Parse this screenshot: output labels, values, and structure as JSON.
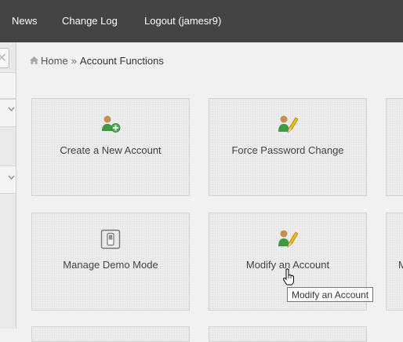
{
  "topnav": {
    "items": [
      {
        "label": "News"
      },
      {
        "label": "Change Log"
      },
      {
        "label": "Logout (jamesr9)"
      }
    ]
  },
  "sidebar": {
    "collapse_icon": "close-icon",
    "chevron_icon": "chevron-down-icon"
  },
  "breadcrumb": {
    "home_icon": "home-icon",
    "home": "Home",
    "separator": "»",
    "current": "Account Functions"
  },
  "tiles": [
    {
      "label": "Create a New Account",
      "icon": "user-add-icon"
    },
    {
      "label": "Force Password Change",
      "icon": "user-edit-icon"
    },
    {
      "label": "Manage Demo Mode",
      "icon": "toggle-switch-icon"
    },
    {
      "label": "Modify an Account",
      "icon": "user-edit-icon"
    },
    {
      "label": "M"
    }
  ],
  "tooltip": {
    "text": "Modify an Account"
  },
  "colors": {
    "nav_bg": "#444444",
    "nav_text": "#ffffff",
    "page_bg": "#f1f1f1",
    "tile_bg": "#ececec",
    "icon_green": "#43a047",
    "icon_yellow": "#f2b705"
  }
}
